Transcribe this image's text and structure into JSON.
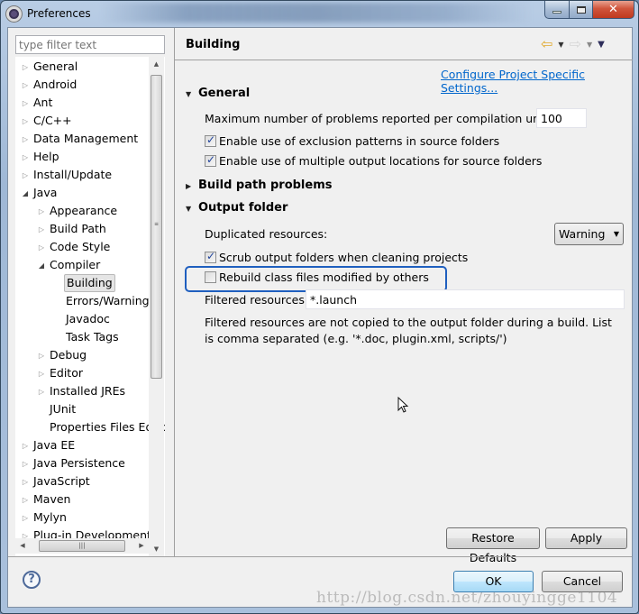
{
  "window": {
    "title": "Preferences",
    "controls": {
      "minimize": "minimize",
      "maximize": "maximize",
      "close": "✕"
    }
  },
  "sidebar": {
    "filter_placeholder": "type filter text",
    "filter_value": "",
    "items": [
      {
        "label": "General",
        "level": 0,
        "expander": "collapsed"
      },
      {
        "label": "Android",
        "level": 0,
        "expander": "collapsed"
      },
      {
        "label": "Ant",
        "level": 0,
        "expander": "collapsed"
      },
      {
        "label": "C/C++",
        "level": 0,
        "expander": "collapsed"
      },
      {
        "label": "Data Management",
        "level": 0,
        "expander": "collapsed"
      },
      {
        "label": "Help",
        "level": 0,
        "expander": "collapsed"
      },
      {
        "label": "Install/Update",
        "level": 0,
        "expander": "collapsed"
      },
      {
        "label": "Java",
        "level": 0,
        "expander": "expanded"
      },
      {
        "label": "Appearance",
        "level": 1,
        "expander": "collapsed"
      },
      {
        "label": "Build Path",
        "level": 1,
        "expander": "collapsed"
      },
      {
        "label": "Code Style",
        "level": 1,
        "expander": "collapsed"
      },
      {
        "label": "Compiler",
        "level": 1,
        "expander": "expanded"
      },
      {
        "label": "Building",
        "level": 2,
        "expander": "none",
        "selected": true
      },
      {
        "label": "Errors/Warnings",
        "level": 2,
        "expander": "none"
      },
      {
        "label": "Javadoc",
        "level": 2,
        "expander": "none"
      },
      {
        "label": "Task Tags",
        "level": 2,
        "expander": "none"
      },
      {
        "label": "Debug",
        "level": 1,
        "expander": "collapsed"
      },
      {
        "label": "Editor",
        "level": 1,
        "expander": "collapsed"
      },
      {
        "label": "Installed JREs",
        "level": 1,
        "expander": "collapsed"
      },
      {
        "label": "JUnit",
        "level": 1,
        "expander": "none"
      },
      {
        "label": "Properties Files Editor",
        "level": 1,
        "expander": "none"
      },
      {
        "label": "Java EE",
        "level": 0,
        "expander": "collapsed"
      },
      {
        "label": "Java Persistence",
        "level": 0,
        "expander": "collapsed"
      },
      {
        "label": "JavaScript",
        "level": 0,
        "expander": "collapsed"
      },
      {
        "label": "Maven",
        "level": 0,
        "expander": "collapsed"
      },
      {
        "label": "Mylyn",
        "level": 0,
        "expander": "collapsed"
      },
      {
        "label": "Plug-in Development",
        "level": 0,
        "expander": "collapsed"
      }
    ]
  },
  "page": {
    "title": "Building",
    "nav": {
      "back": "⇦",
      "forward": "⇨",
      "dropdown": "▼",
      "menu": "▼"
    },
    "config_link": "Configure Project Specific Settings...",
    "sections": {
      "general": {
        "title": "General",
        "expanded": true,
        "max_problems_label": "Maximum number of problems reported per compilation unit:",
        "max_problems_value": "100",
        "exclusion_patterns": {
          "label": "Enable use of exclusion patterns in source folders",
          "checked": true
        },
        "multiple_output": {
          "label": "Enable use of multiple output locations for source folders",
          "checked": true
        }
      },
      "build_path_problems": {
        "title": "Build path problems",
        "expanded": false
      },
      "output_folder": {
        "title": "Output folder",
        "expanded": true,
        "duplicated_label": "Duplicated resources:",
        "duplicated_value": "Warning",
        "scrub": {
          "label": "Scrub output folders when cleaning projects",
          "checked": true
        },
        "rebuild": {
          "label": "Rebuild class files modified by others",
          "checked": false
        },
        "filtered_label": "Filtered resources:",
        "filtered_value": "*.launch",
        "help_text": "Filtered resources are not copied to the output folder during a build. List is comma separated (e.g. '*.doc, plugin.xml, scripts/')"
      }
    },
    "buttons": {
      "restore_defaults": "Restore Defaults",
      "apply": "Apply"
    }
  },
  "footer": {
    "help_icon": "?",
    "ok": "OK",
    "cancel": "Cancel",
    "watermark": "http://blog.csdn.net/zhouyingge1104"
  },
  "colors": {
    "link": "#0066cc",
    "highlight_box": "#1f5fbf",
    "back_arrow": "#e0a82a"
  }
}
